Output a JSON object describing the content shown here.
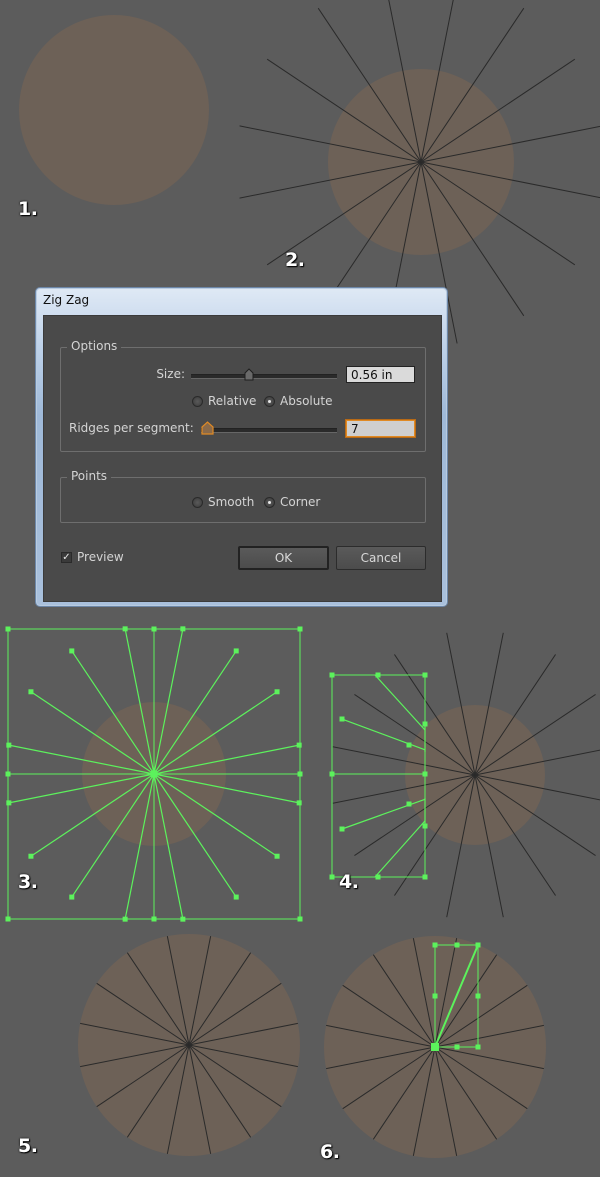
{
  "steps": [
    "1.",
    "2.",
    "3.",
    "4.",
    "5.",
    "6."
  ],
  "colors": {
    "canvas": "#5c5c5c",
    "circle": "#6d6157",
    "line": "#2a2a2a",
    "selection": "#5cf25c"
  },
  "dialog": {
    "title": "Zig Zag",
    "options_title": "Options",
    "size_label": "Size:",
    "size_value": "0.56 in",
    "size_slider_fraction": 0.4,
    "relative_label": "Relative",
    "absolute_label": "Absolute",
    "ridges_label": "Ridges per segment:",
    "ridges_value": "7",
    "ridges_slider_fraction": 0.05,
    "points_title": "Points",
    "smooth_label": "Smooth",
    "corner_label": "Corner",
    "preview_label": "Preview",
    "ok_label": "OK",
    "cancel_label": "Cancel"
  }
}
